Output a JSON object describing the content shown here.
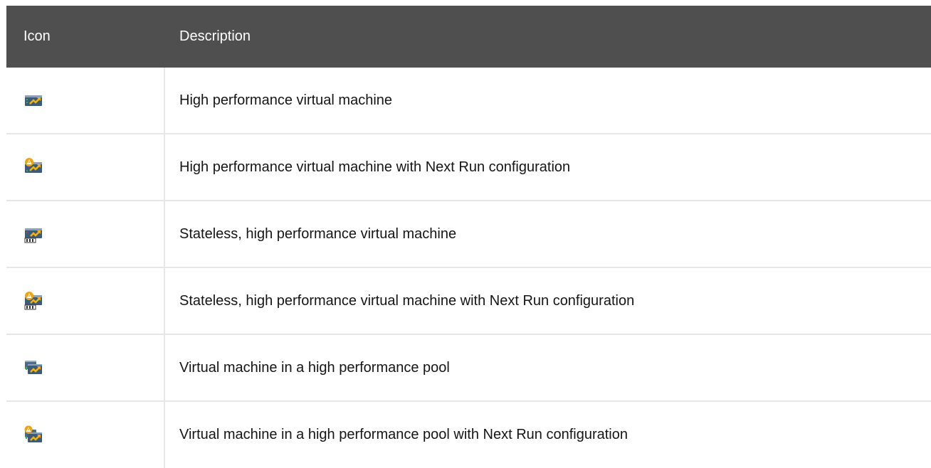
{
  "table": {
    "headers": {
      "icon": "Icon",
      "description": "Description"
    },
    "rows": [
      {
        "icon": "high-performance-vm-icon",
        "description": "High performance virtual machine"
      },
      {
        "icon": "high-performance-vm-next-run-icon",
        "description": "High performance virtual machine with Next Run configuration"
      },
      {
        "icon": "stateless-high-performance-vm-icon",
        "description": "Stateless, high performance virtual machine"
      },
      {
        "icon": "stateless-high-performance-vm-next-run-icon",
        "description": "Stateless, high performance virtual machine with Next Run configuration"
      },
      {
        "icon": "high-performance-pool-vm-icon",
        "description": "Virtual machine in a high performance pool"
      },
      {
        "icon": "high-performance-pool-vm-next-run-icon",
        "description": "Virtual machine in a high performance pool with Next Run configuration"
      }
    ]
  },
  "colors": {
    "header_bg": "#4f4f4f",
    "header_text": "#ffffff",
    "row_border": "#e7e7e7",
    "icon_body": "#3d5a7a",
    "icon_arrow": "#f5b400",
    "status_green": "#2fb34a",
    "warning_orange": "#f0a30a"
  }
}
